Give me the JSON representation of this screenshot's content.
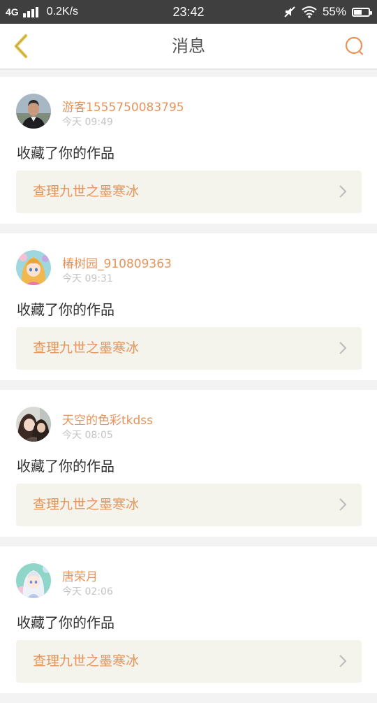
{
  "status_bar": {
    "network": "4G",
    "speed": "0.2K/s",
    "time": "23:42",
    "battery": "55%",
    "battery_level": 0.55,
    "icons": [
      "signal-icon",
      "mute-icon",
      "wifi-icon",
      "battery-icon"
    ]
  },
  "header": {
    "title": "消息",
    "back_icon": "chevron-left-icon",
    "search_icon": "search-icon"
  },
  "colors": {
    "accent": "#e8935a",
    "back_arrow": "#e5c44a",
    "status_bar_bg": "#3f3f3f",
    "card_bg": "#ffffff",
    "link_bg": "#f4f4ec",
    "page_bg": "#f3f3f3"
  },
  "messages": [
    {
      "username": "游客1555750083795",
      "time": "今天 09:49",
      "text": "收藏了你的作品",
      "work": "查理九世之墨寒冰",
      "avatar": "man-photo-avatar"
    },
    {
      "username": "椿树园_910809363",
      "time": "今天 09:31",
      "text": "收藏了你的作品",
      "work": "查理九世之墨寒冰",
      "avatar": "anime-girl-avatar"
    },
    {
      "username": "天空的色彩tkdss",
      "time": "今天 08:05",
      "text": "收藏了你的作品",
      "work": "查理九世之墨寒冰",
      "avatar": "couple-photo-avatar"
    },
    {
      "username": "唐荣月",
      "time": "今天 02:06",
      "text": "收藏了你的作品",
      "work": "查理九世之墨寒冰",
      "avatar": "anime-white-hair-avatar"
    }
  ]
}
